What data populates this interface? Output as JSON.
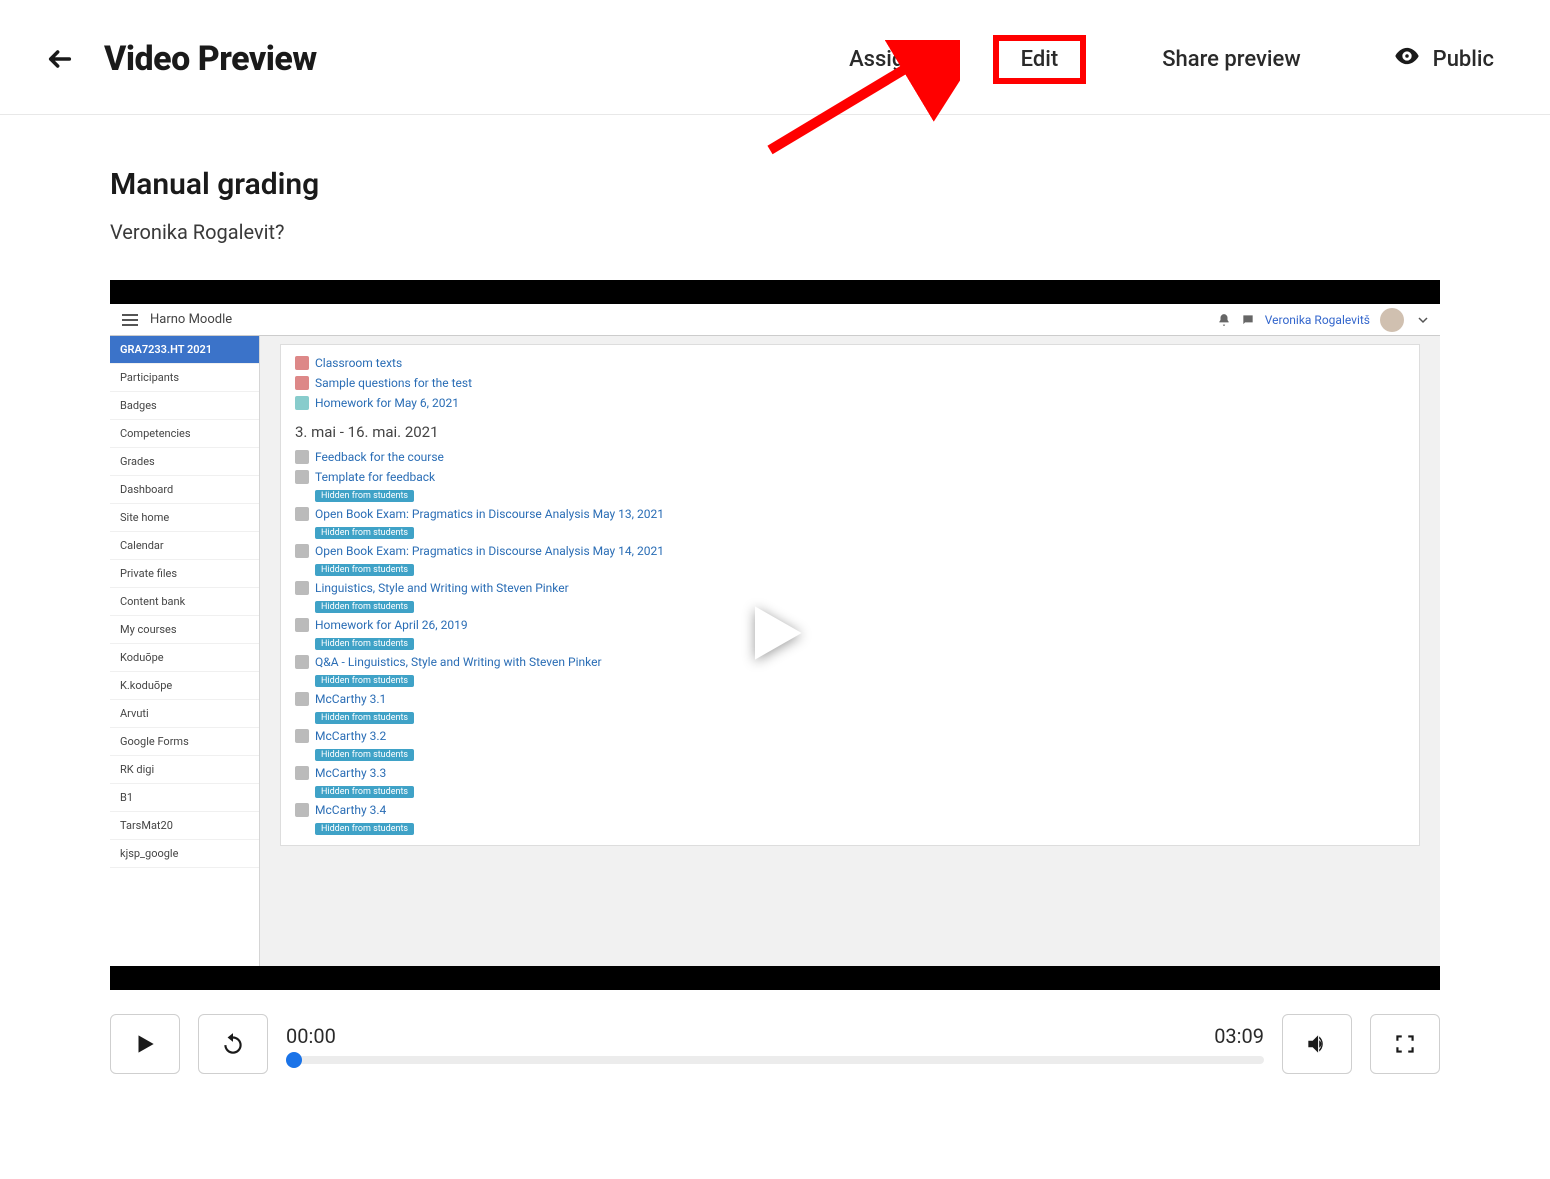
{
  "header": {
    "page_title": "Video Preview",
    "actions": {
      "assign": "Assign",
      "edit": "Edit",
      "share": "Share preview",
      "visibility": "Public"
    }
  },
  "video": {
    "title": "Manual grading",
    "author": "Veronika Rogalevit?",
    "current_time": "00:00",
    "duration": "03:09"
  },
  "moodle": {
    "brand": "Harno Moodle",
    "user_name": "Veronika Rogalevitš",
    "sidebar": [
      {
        "label": "GRA7233.HT 2021",
        "active": true
      },
      {
        "label": "Participants"
      },
      {
        "label": "Badges"
      },
      {
        "label": "Competencies"
      },
      {
        "label": "Grades"
      },
      {
        "label": "Dashboard"
      },
      {
        "label": "Site home"
      },
      {
        "label": "Calendar"
      },
      {
        "label": "Private files"
      },
      {
        "label": "Content bank"
      },
      {
        "label": "My courses"
      },
      {
        "label": "Koduõpe"
      },
      {
        "label": "K.koduõpe"
      },
      {
        "label": "Arvuti"
      },
      {
        "label": "Google Forms"
      },
      {
        "label": "RK digi"
      },
      {
        "label": "B1"
      },
      {
        "label": "TarsMat20"
      },
      {
        "label": "kjsp_google"
      }
    ],
    "top_links": [
      "Classroom texts",
      "Sample questions for the test",
      "Homework for May 6, 2021"
    ],
    "section_heading": "3. mai - 16. mai. 2021",
    "hidden_label": "Hidden from students",
    "items": [
      {
        "text": "Feedback for the course",
        "hidden": false
      },
      {
        "text": "Template for feedback",
        "hidden": true
      },
      {
        "text": "Open Book Exam: Pragmatics in Discourse Analysis May 13, 2021",
        "hidden": true
      },
      {
        "text": "Open Book Exam: Pragmatics in Discourse Analysis May 14, 2021",
        "hidden": true
      },
      {
        "text": "Linguistics, Style and Writing with Steven Pinker",
        "hidden": true
      },
      {
        "text": "Homework for April 26, 2019",
        "hidden": true
      },
      {
        "text": "Q&A - Linguistics, Style and Writing with Steven Pinker",
        "hidden": true
      },
      {
        "text": "McCarthy 3.1",
        "hidden": true
      },
      {
        "text": "McCarthy 3.2",
        "hidden": true
      },
      {
        "text": "McCarthy 3.3",
        "hidden": true
      },
      {
        "text": "McCarthy 3.4",
        "hidden": true
      }
    ]
  }
}
